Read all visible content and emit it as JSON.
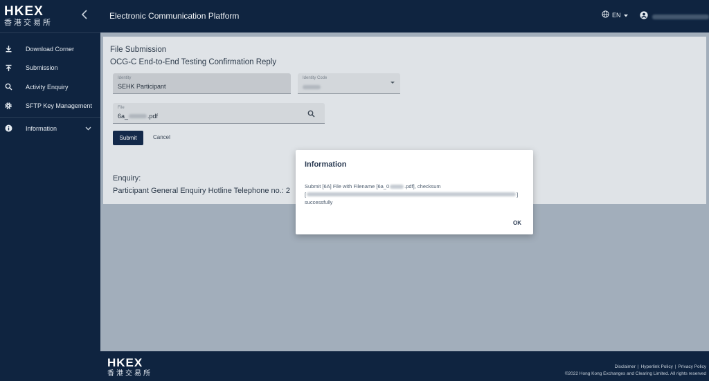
{
  "brand": {
    "logo_en": "HKEX",
    "logo_cn": "香港交易所"
  },
  "header": {
    "title": "Electronic Communication Platform",
    "lang": "EN"
  },
  "sidebar": {
    "items": [
      {
        "label": "Download Corner",
        "icon": "download-icon"
      },
      {
        "label": "Submission",
        "icon": "upload-icon"
      },
      {
        "label": "Activity Enquiry",
        "icon": "search-icon"
      },
      {
        "label": "SFTP Key Management",
        "icon": "gear-icon"
      },
      {
        "label": "Information",
        "icon": "info-icon"
      }
    ]
  },
  "page": {
    "title": "File Submission",
    "subtitle": "OCG-C End-to-End Testing Confirmation Reply",
    "identity_label": "Identity",
    "identity_value": "SEHK Participant",
    "identity_code_label": "Identity Code",
    "file_label": "File",
    "file_value_prefix": "6a_",
    "file_value_suffix": ".pdf",
    "submit_label": "Submit",
    "cancel_label": "Cancel",
    "enquiry_label": "Enquiry:",
    "enquiry_line": "Participant General Enquiry Hotline Telephone no.: 2"
  },
  "modal": {
    "title": "Information",
    "msg_part1": "Submit [6A] File with Filename [6a_0",
    "msg_part2": ".pdf], checksum",
    "msg_open": "[",
    "msg_close": "]",
    "msg_end": "successfully",
    "ok_label": "OK"
  },
  "footer": {
    "disclaimer": "Disclaimer",
    "hyperlink": "Hyperlink Policy",
    "privacy": "Privacy Policy",
    "separator": "|",
    "copyright": "©2022 Hong Kong Exchanges and Clearing Limited. All rights reserved"
  },
  "colors": {
    "nav_bg": "#0f2440",
    "primary_button": "#13294a",
    "overlay": "#9aa7b4"
  }
}
